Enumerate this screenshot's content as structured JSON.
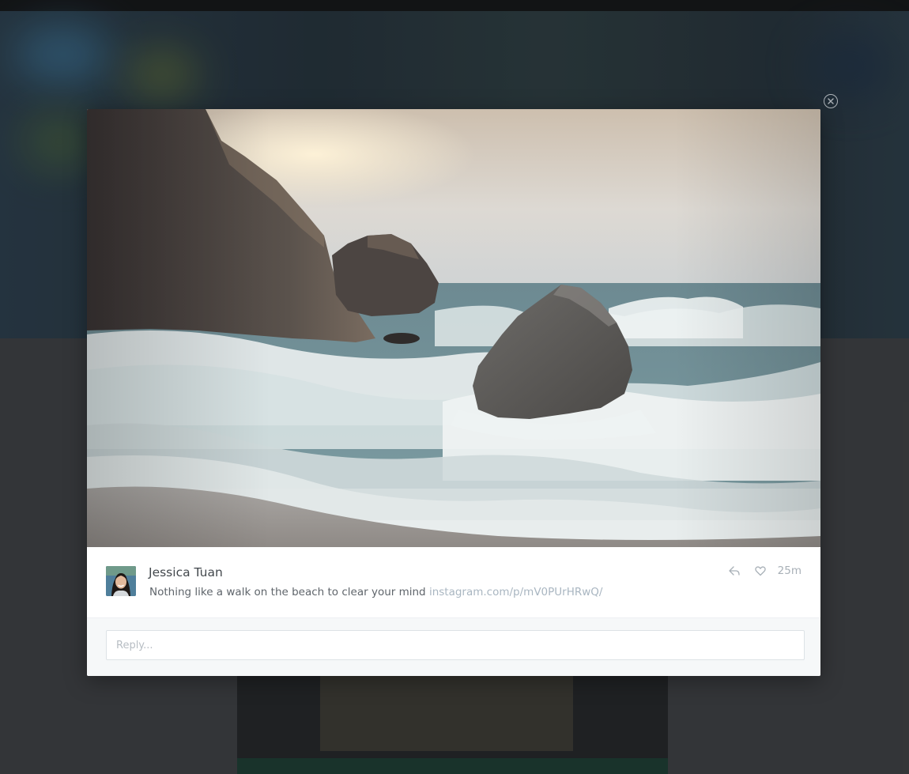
{
  "post": {
    "author": "Jessica Tuan",
    "message_text": "Nothing like a walk on the beach to clear your mind",
    "link_text": "instagram.com/p/mV0PUrHRwQ/",
    "time": "25m"
  },
  "reply": {
    "placeholder": "Reply..."
  },
  "icons": {
    "close": "close-circle-icon",
    "reply": "reply-icon",
    "like": "heart-icon"
  },
  "colors": {
    "accent_link": "#a9b6c1",
    "modal_bg": "#ffffff",
    "reply_bg": "#f6f8f9"
  }
}
